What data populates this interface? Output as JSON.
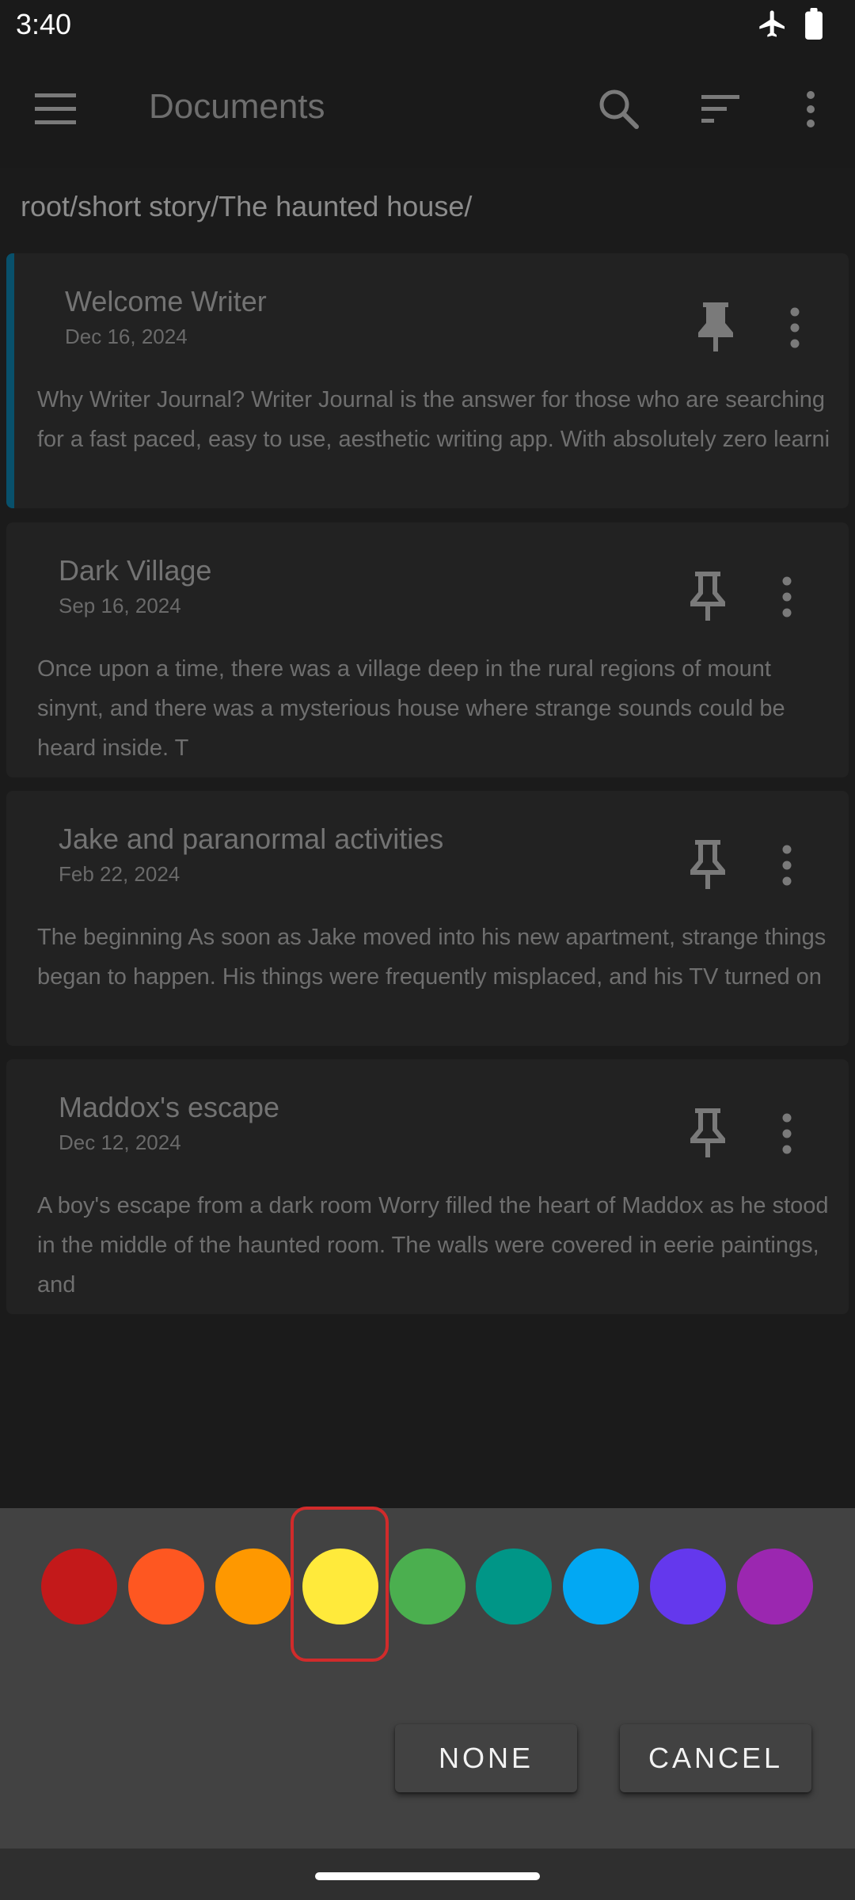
{
  "status_bar": {
    "time": "3:40"
  },
  "app_bar": {
    "title": "Documents"
  },
  "breadcrumb": "root/short story/The haunted house/",
  "documents": [
    {
      "title": "Welcome Writer",
      "date": "Dec 16, 2024",
      "preview": "Why Writer Journal? Writer Journal is the answer for those who are searching for a fast paced, easy to use, aesthetic writing app. With absolutely zero learni",
      "pinned": true,
      "accent_color": "#08506b"
    },
    {
      "title": "Dark Village",
      "date": "Sep 16, 2024",
      "preview": "Once upon a time, there was a village deep in the rural regions of mount sinynt, and there was a mysterious house where strange sounds could be heard inside. T",
      "pinned": false
    },
    {
      "title": "Jake and paranormal activities",
      "date": "Feb 22, 2024",
      "preview": " The beginning As soon as Jake moved into his new apartment, strange things began to happen. His things were frequently misplaced, and his TV turned on",
      "pinned": false
    },
    {
      "title": "Maddox's escape",
      "date": "Dec 12, 2024",
      "preview": "A boy's escape from a dark room Worry filled the heart of Maddox as he stood in the middle of the haunted room. The walls were covered in eerie paintings, and",
      "pinned": false
    }
  ],
  "color_picker": {
    "colors": [
      "#c3191a",
      "#fe5721",
      "#fe9800",
      "#ffea3b",
      "#4baf4f",
      "#009687",
      "#02a8f3",
      "#6438ed",
      "#9b27b0"
    ],
    "selected_index": 3,
    "none_label": "NONE",
    "cancel_label": "CANCEL"
  }
}
